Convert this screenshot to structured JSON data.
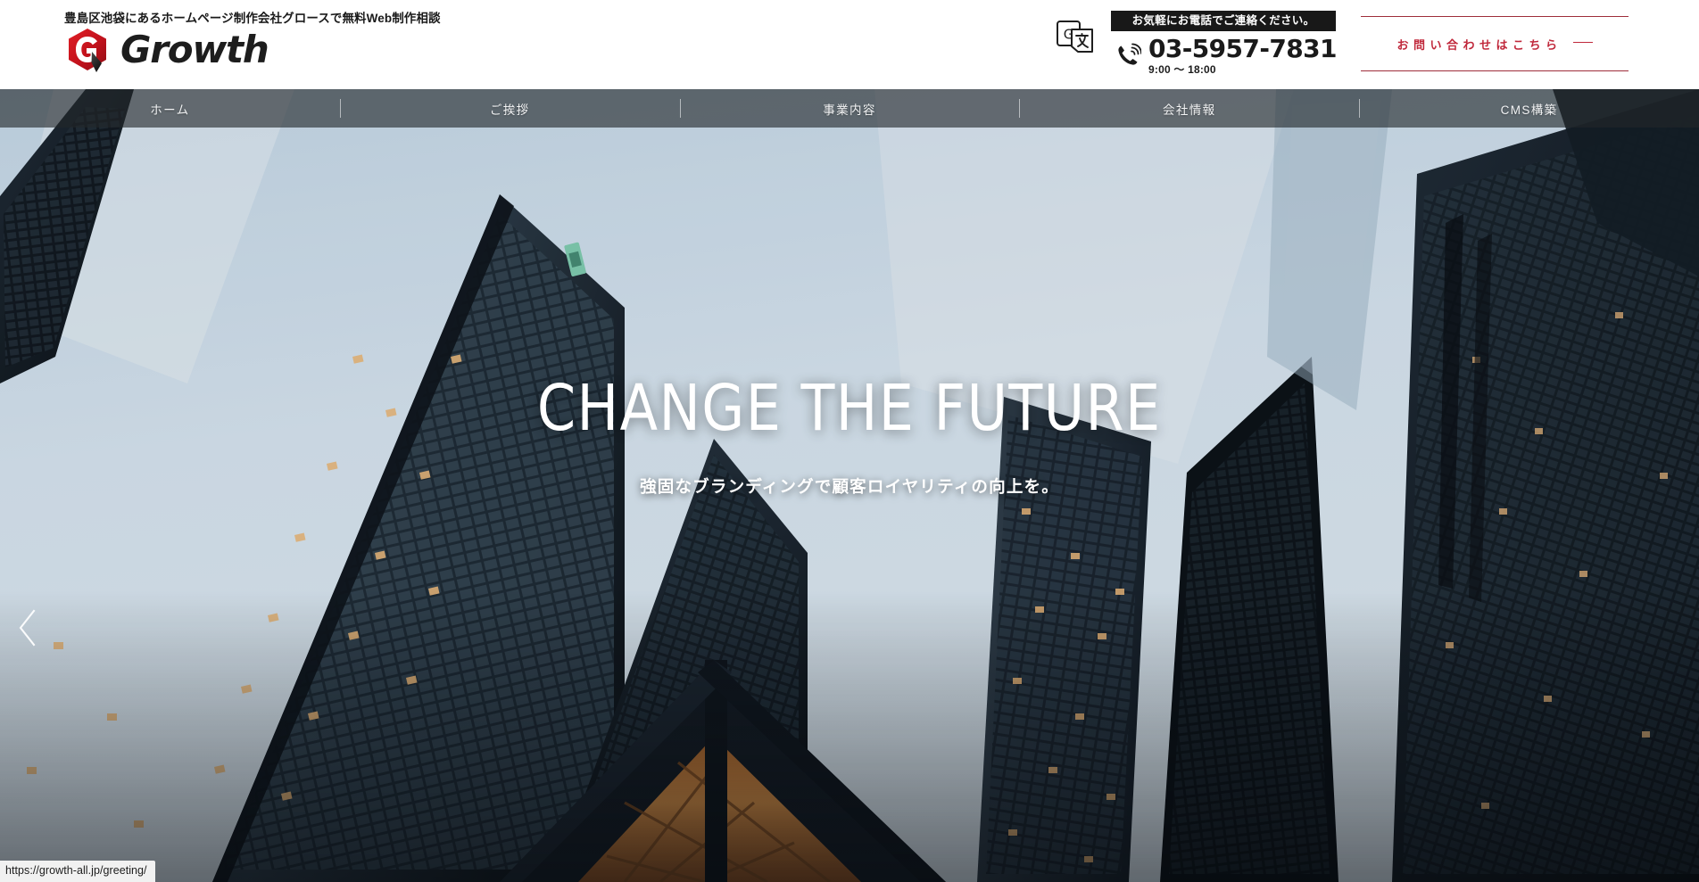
{
  "header": {
    "tagline": "豊島区池袋にあるホームページ制作会社グロースで無料Web制作相談",
    "logo_text": "Growth",
    "translate_icon": "google-translate-icon",
    "phone": {
      "banner": "お気軽にお電話でご連絡ください。",
      "number": "03-5957-7831",
      "hours": "9:00 ～ 18:00",
      "icon": "phone-ringing-icon"
    },
    "contact_cta": {
      "label": "お問い合わせはこちら",
      "dash_icon": "horizontal-dash-icon",
      "color": "#c0283b",
      "border_color": "#9e2d3a"
    }
  },
  "nav": {
    "items": [
      {
        "label": "ホーム"
      },
      {
        "label": "ご挨拶"
      },
      {
        "label": "事業内容"
      },
      {
        "label": "会社情報"
      },
      {
        "label": "CMS構築"
      }
    ],
    "background": "rgba(36,38,41,0.62)"
  },
  "hero": {
    "title": "CHANGE THE FUTURE",
    "subtitle": "強固なブランディングで顧客ロイヤリティの向上を。",
    "prev_arrow_icon": "chevron-left-icon",
    "image_description": "低い位置から見上げた高層ビル群",
    "sky_color": "#cfdeea",
    "building_color": "#1a2430",
    "window_glow_color": "#c8823c"
  },
  "status_bar": {
    "url": "https://growth-all.jp/greeting/"
  }
}
